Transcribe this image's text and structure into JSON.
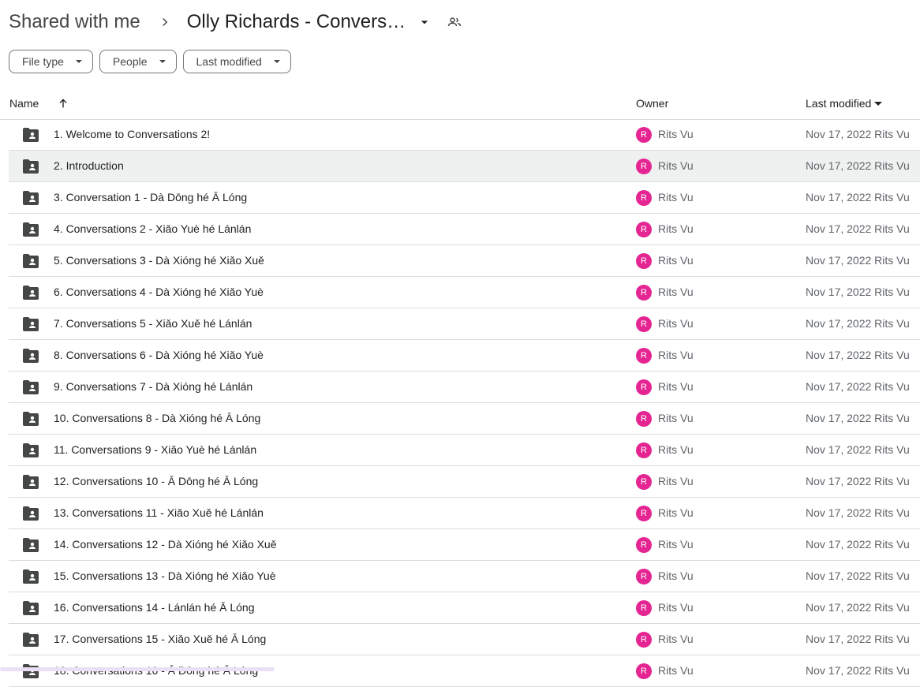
{
  "breadcrumb": {
    "root": "Shared with me",
    "current": "Olly Richards - Convers…"
  },
  "filters": {
    "file_type": "File type",
    "people": "People",
    "last_modified": "Last modified"
  },
  "table": {
    "headers": {
      "name": "Name",
      "owner": "Owner",
      "last_modified": "Last modified"
    },
    "rows": [
      {
        "name": "1. Welcome to Conversations 2!",
        "owner_initial": "R",
        "owner": "Rits Vu",
        "modified": "Nov 17, 2022 Rits Vu"
      },
      {
        "name": "2. Introduction",
        "owner_initial": "R",
        "owner": "Rits Vu",
        "modified": "Nov 17, 2022 Rits Vu"
      },
      {
        "name": "3. Conversation 1 - Dà Dōng hé Ā Lóng",
        "owner_initial": "R",
        "owner": "Rits Vu",
        "modified": "Nov 17, 2022 Rits Vu"
      },
      {
        "name": "4. Conversations 2 - Xiǎo Yuè hé Lánlán",
        "owner_initial": "R",
        "owner": "Rits Vu",
        "modified": "Nov 17, 2022 Rits Vu"
      },
      {
        "name": "5. Conversations 3 - Dà Xióng hé Xiǎo Xuě",
        "owner_initial": "R",
        "owner": "Rits Vu",
        "modified": "Nov 17, 2022 Rits Vu"
      },
      {
        "name": "6. Conversations 4 - Dà Xióng hé Xiǎo Yuè",
        "owner_initial": "R",
        "owner": "Rits Vu",
        "modified": "Nov 17, 2022 Rits Vu"
      },
      {
        "name": "7. Conversations 5 - Xiǎo Xuě hé Lánlán",
        "owner_initial": "R",
        "owner": "Rits Vu",
        "modified": "Nov 17, 2022 Rits Vu"
      },
      {
        "name": "8. Conversations 6 - Dà Xióng hé Xiǎo Yuè",
        "owner_initial": "R",
        "owner": "Rits Vu",
        "modified": "Nov 17, 2022 Rits Vu"
      },
      {
        "name": "9. Conversations 7 - Dà Xióng hé Lánlán",
        "owner_initial": "R",
        "owner": "Rits Vu",
        "modified": "Nov 17, 2022 Rits Vu"
      },
      {
        "name": "10. Conversations 8 - Dà Xióng hé Ā Lóng",
        "owner_initial": "R",
        "owner": "Rits Vu",
        "modified": "Nov 17, 2022 Rits Vu"
      },
      {
        "name": "11. Conversations 9 - Xiǎo Yuè hé Lánlán",
        "owner_initial": "R",
        "owner": "Rits Vu",
        "modified": "Nov 17, 2022 Rits Vu"
      },
      {
        "name": "12. Conversations 10 - Ā Dōng hé Ā Lóng",
        "owner_initial": "R",
        "owner": "Rits Vu",
        "modified": "Nov 17, 2022 Rits Vu"
      },
      {
        "name": "13. Conversations 11 - Xiǎo Xuě hé Lánlán",
        "owner_initial": "R",
        "owner": "Rits Vu",
        "modified": "Nov 17, 2022 Rits Vu"
      },
      {
        "name": "14. Conversations 12 - Dà Xióng hé Xiǎo Xuě",
        "owner_initial": "R",
        "owner": "Rits Vu",
        "modified": "Nov 17, 2022 Rits Vu"
      },
      {
        "name": "15. Conversations 13 - Dà Xióng hé Xiǎo Yuè",
        "owner_initial": "R",
        "owner": "Rits Vu",
        "modified": "Nov 17, 2022 Rits Vu"
      },
      {
        "name": "16. Conversations 14 - Lánlán hé Ā Lóng",
        "owner_initial": "R",
        "owner": "Rits Vu",
        "modified": "Nov 17, 2022 Rits Vu"
      },
      {
        "name": "17. Conversations 15 - Xiǎo Xuě hé Ā Lóng",
        "owner_initial": "R",
        "owner": "Rits Vu",
        "modified": "Nov 17, 2022 Rits Vu"
      },
      {
        "name": "18. Conversations 16 - Ā Dōng hé Ā Lóng",
        "owner_initial": "R",
        "owner": "Rits Vu",
        "modified": "Nov 17, 2022 Rits Vu"
      }
    ]
  },
  "colors": {
    "avatar": "#e52592",
    "selected_row": "#eff1f0",
    "folder_icon": "#444746"
  },
  "icons": {
    "breadcrumb_separator": "chevron-right-icon",
    "dropdown": "arrow-drop-down-icon",
    "shared": "people-icon",
    "sort": "arrow-up-icon",
    "row": "shared-folder-icon"
  }
}
